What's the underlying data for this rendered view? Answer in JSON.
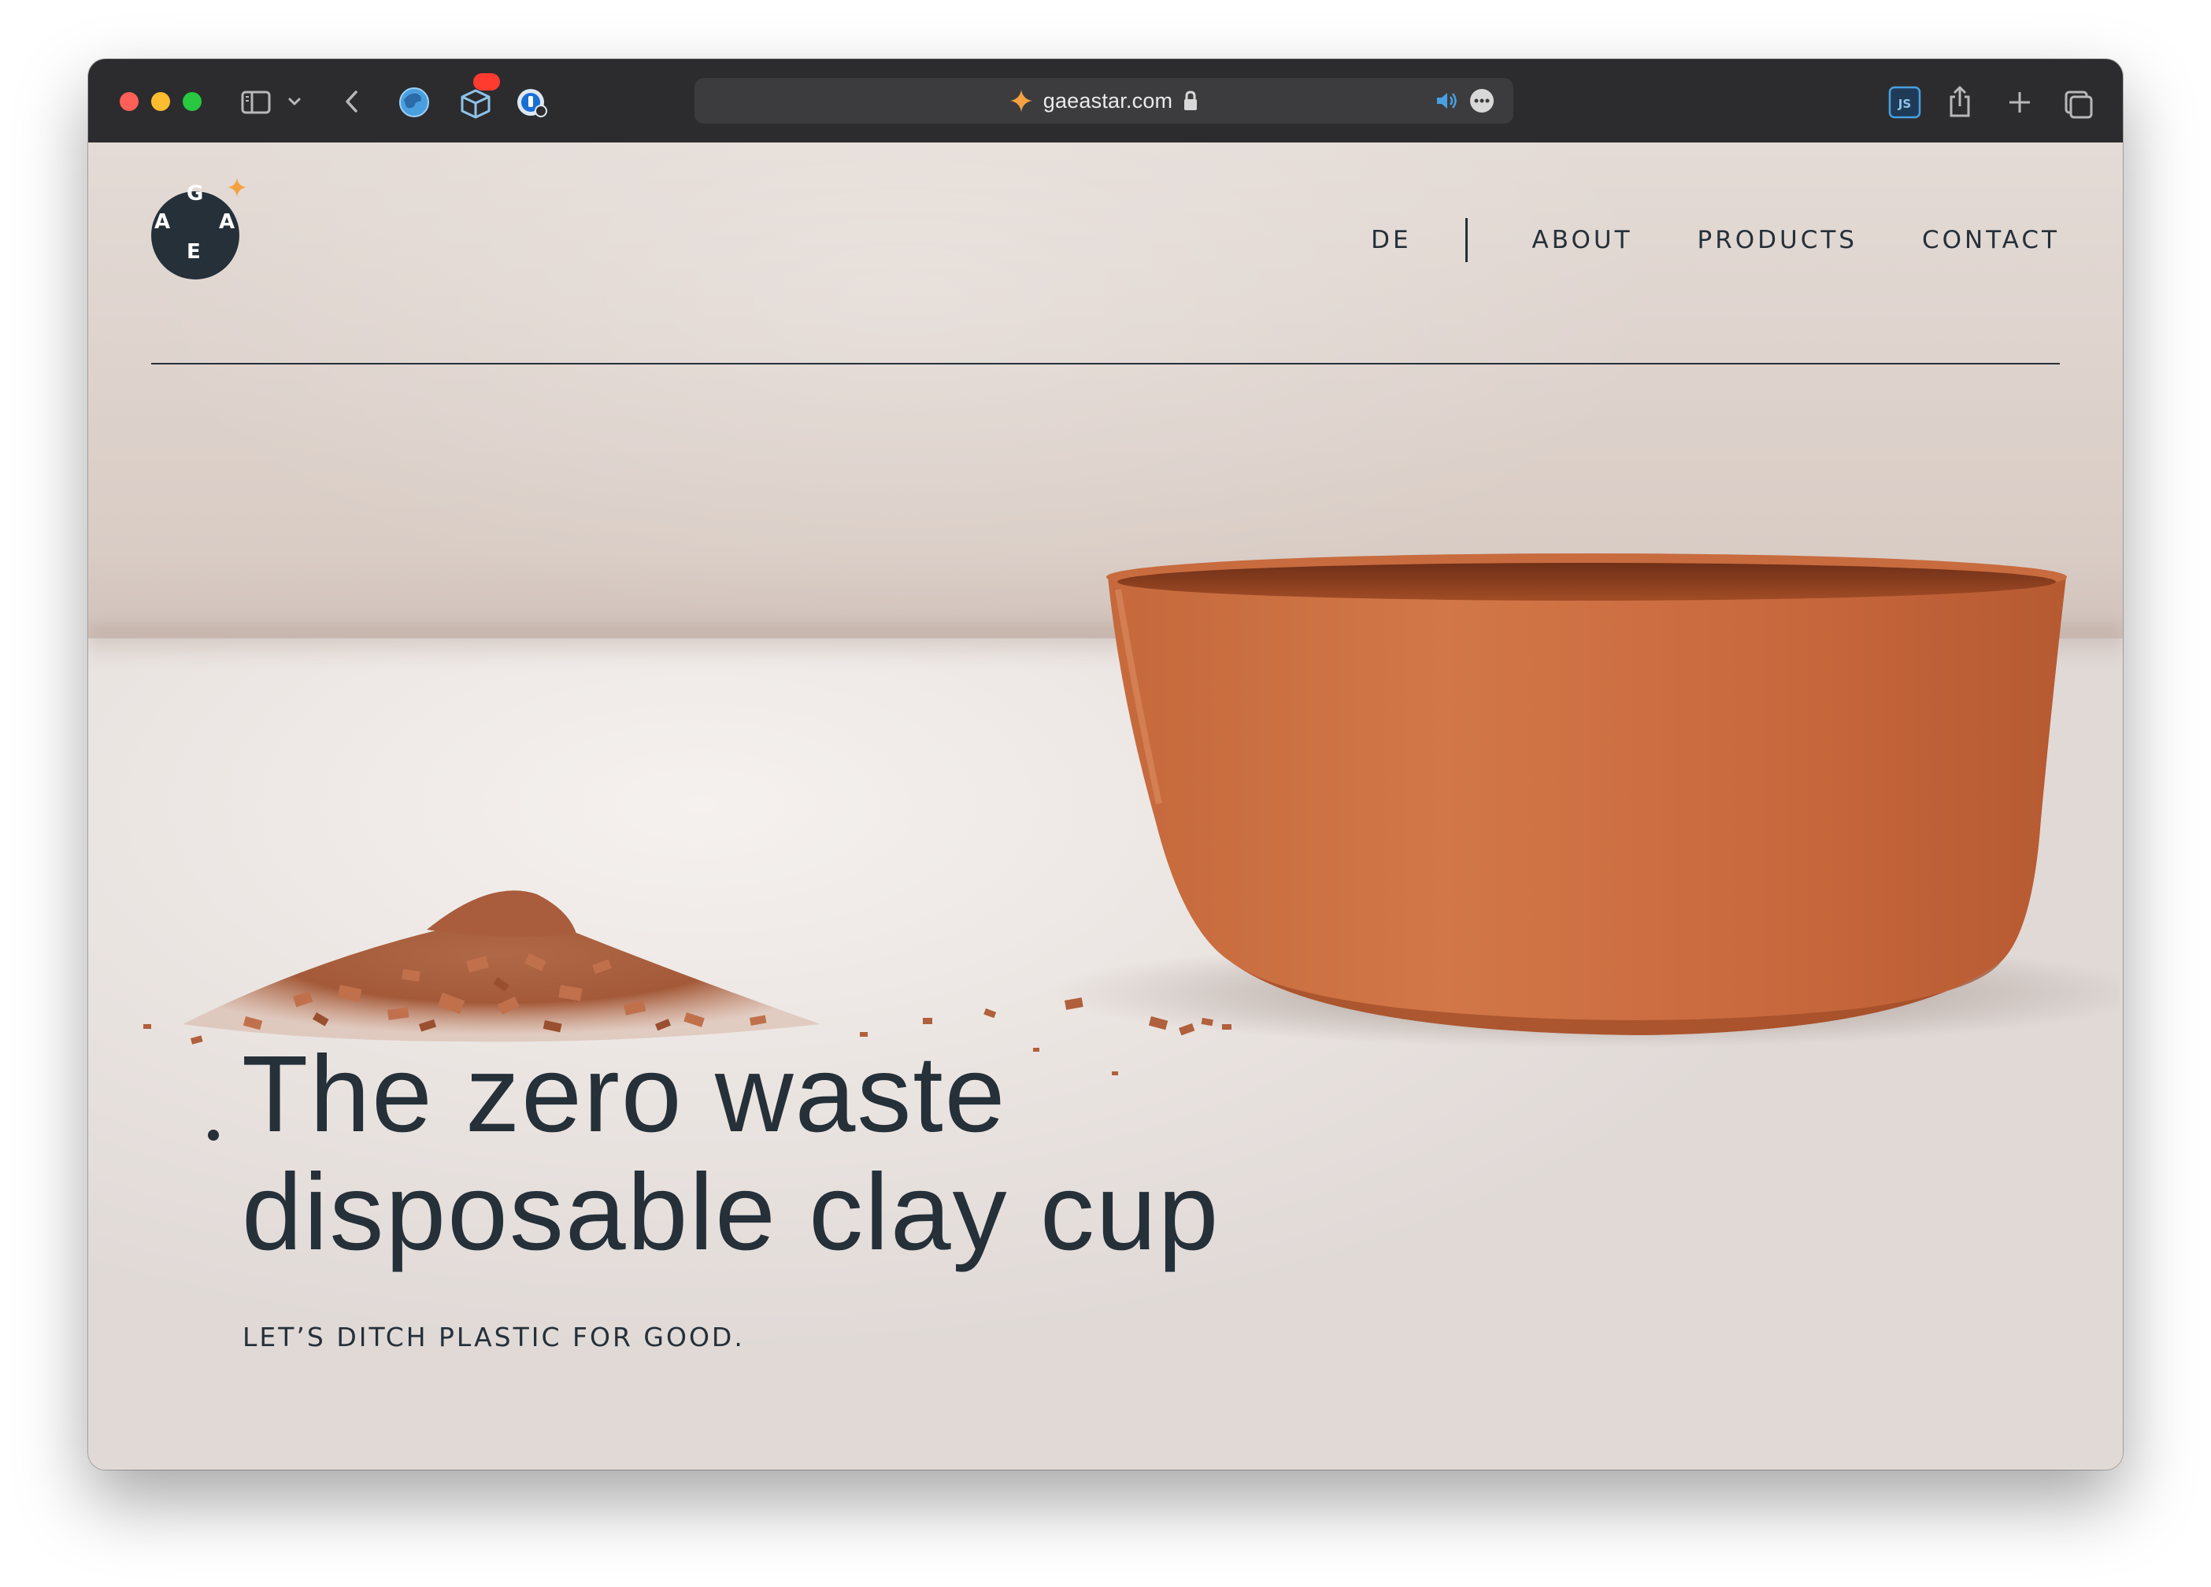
{
  "browser": {
    "url": "gaeastar.com",
    "icons": {
      "sidebar": "sidebar-icon",
      "back": "chevron-left-icon",
      "extension1": "globe-extension-icon",
      "extension2": "package-extension-icon",
      "extension3": "password-extension-icon",
      "site": "sparkle-icon",
      "secure": "lock-icon",
      "audio": "speaker-icon",
      "more": "ellipsis-icon",
      "js": "JS",
      "share": "share-icon",
      "new_tab": "plus-icon",
      "tabs": "tab-overview-icon"
    },
    "colors": {
      "toolbar": "#2c2c2e",
      "close": "#fe5f57",
      "minimize": "#febc2e",
      "zoom": "#28c840",
      "badge": "#ff3b30"
    }
  },
  "site": {
    "logo_letters": {
      "top": "G",
      "left": "A",
      "right": "A",
      "bottom": "E"
    },
    "nav": {
      "language": "DE",
      "about": "ABOUT",
      "products": "PRODUCTS",
      "contact": "CONTACT"
    },
    "hero": {
      "title_line1": "The zero waste",
      "title_line2": "disposable clay cup",
      "subtitle": "LET’S DITCH PLASTIC FOR GOOD."
    },
    "colors": {
      "ink": "#253039",
      "accent": "#f5a142",
      "clay": "#c4633a"
    }
  }
}
